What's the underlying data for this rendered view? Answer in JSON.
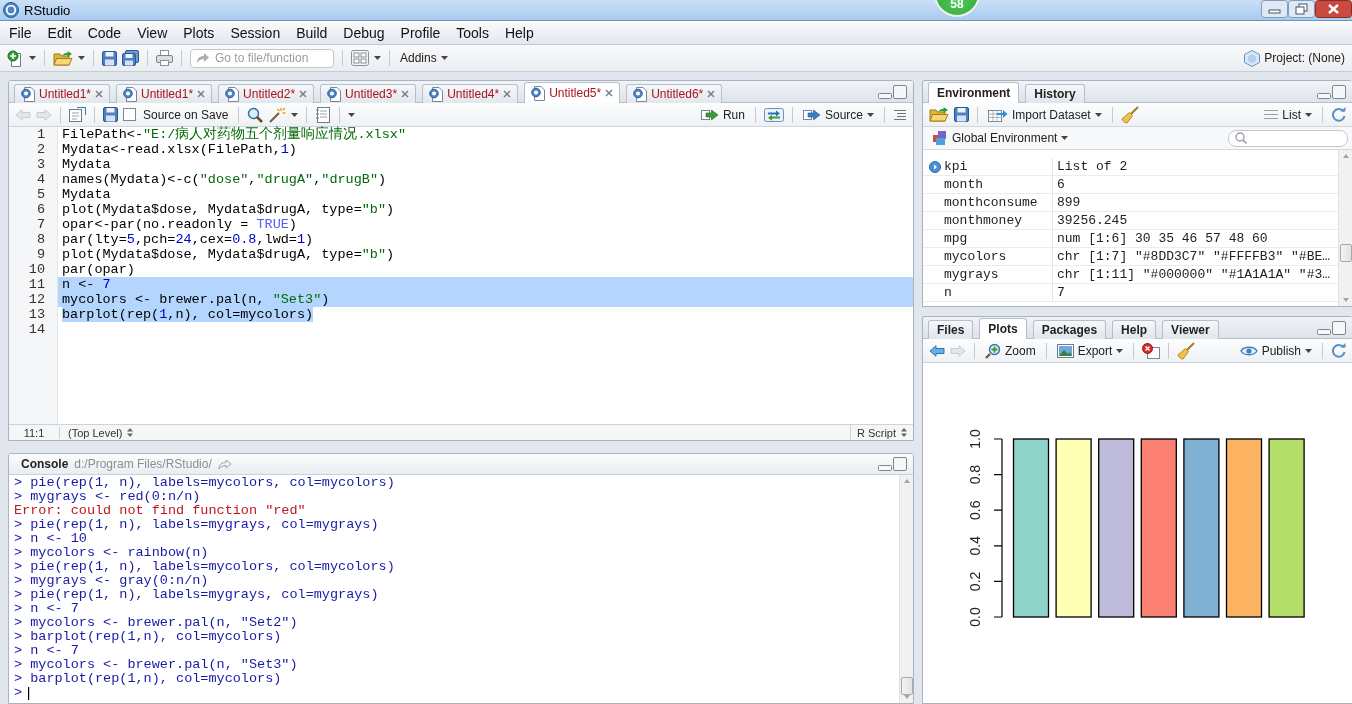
{
  "window": {
    "title": "RStudio",
    "badge": "58"
  },
  "menu": [
    "File",
    "Edit",
    "Code",
    "View",
    "Plots",
    "Session",
    "Build",
    "Debug",
    "Profile",
    "Tools",
    "Help"
  ],
  "toolbar": {
    "goto_placeholder": "Go to file/function",
    "addins": "Addins",
    "project": "Project: (None)"
  },
  "source": {
    "tabs": [
      {
        "label": "Untitled1*",
        "selected": false,
        "modified": true
      },
      {
        "label": "Untitled1*",
        "selected": false,
        "modified": true
      },
      {
        "label": "Untitled2*",
        "selected": false,
        "modified": true
      },
      {
        "label": "Untitled3*",
        "selected": false,
        "modified": true
      },
      {
        "label": "Untitled4*",
        "selected": false,
        "modified": true
      },
      {
        "label": "Untitled5*",
        "selected": true,
        "modified": true
      },
      {
        "label": "Untitled6*",
        "selected": false,
        "modified": true
      }
    ],
    "nav": [
      {
        "kind": "back",
        "disabled": true
      },
      {
        "kind": "forward",
        "disabled": true
      }
    ],
    "source_on_save": {
      "label": "Source on Save",
      "checked": false
    },
    "run": "Run",
    "source": "Source",
    "lines": [
      {
        "number": "1",
        "selected": false,
        "tokens": [
          {
            "kind": "text",
            "text": "FilePath<-"
          },
          {
            "kind": "string",
            "text": "\"E:/病人对药物五个剂量响应情况.xlsx\""
          }
        ]
      },
      {
        "number": "2",
        "selected": false,
        "tokens": [
          {
            "kind": "text",
            "text": "Mydata<-read.xlsx(FilePath,"
          },
          {
            "kind": "number",
            "text": "1"
          },
          {
            "kind": "text",
            "text": ")"
          }
        ]
      },
      {
        "number": "3",
        "selected": false,
        "tokens": [
          {
            "kind": "text",
            "text": "Mydata"
          }
        ]
      },
      {
        "number": "4",
        "selected": false,
        "tokens": [
          {
            "kind": "text",
            "text": "names(Mydata)<-c("
          },
          {
            "kind": "string",
            "text": "\"dose\""
          },
          {
            "kind": "text",
            "text": ","
          },
          {
            "kind": "string",
            "text": "\"drugA\""
          },
          {
            "kind": "text",
            "text": ","
          },
          {
            "kind": "string",
            "text": "\"drugB\""
          },
          {
            "kind": "text",
            "text": ")"
          }
        ]
      },
      {
        "number": "5",
        "selected": false,
        "tokens": [
          {
            "kind": "text",
            "text": "Mydata"
          }
        ]
      },
      {
        "number": "6",
        "selected": false,
        "tokens": [
          {
            "kind": "text",
            "text": "plot(Mydata$dose, Mydata$drugA, type="
          },
          {
            "kind": "string",
            "text": "\"b\""
          },
          {
            "kind": "text",
            "text": ")"
          }
        ]
      },
      {
        "number": "7",
        "selected": false,
        "tokens": [
          {
            "kind": "text",
            "text": "opar<-par(no.readonly = "
          },
          {
            "kind": "keyword",
            "text": "TRUE"
          },
          {
            "kind": "text",
            "text": ")"
          }
        ]
      },
      {
        "number": "8",
        "selected": false,
        "tokens": [
          {
            "kind": "text",
            "text": "par(lty="
          },
          {
            "kind": "number",
            "text": "5"
          },
          {
            "kind": "text",
            "text": ",pch="
          },
          {
            "kind": "number",
            "text": "24"
          },
          {
            "kind": "text",
            "text": ",cex="
          },
          {
            "kind": "number",
            "text": "0.8"
          },
          {
            "kind": "text",
            "text": ",lwd="
          },
          {
            "kind": "number",
            "text": "1"
          },
          {
            "kind": "text",
            "text": ")"
          }
        ]
      },
      {
        "number": "9",
        "selected": false,
        "tokens": [
          {
            "kind": "text",
            "text": "plot(Mydata$dose, Mydata$drugA, type="
          },
          {
            "kind": "string",
            "text": "\"b\""
          },
          {
            "kind": "text",
            "text": ")"
          }
        ]
      },
      {
        "number": "10",
        "selected": false,
        "tokens": [
          {
            "kind": "text",
            "text": "par(opar)"
          }
        ]
      },
      {
        "number": "11",
        "selected": true,
        "tokens": [
          {
            "kind": "text",
            "text": "n <- "
          },
          {
            "kind": "number",
            "text": "7"
          }
        ]
      },
      {
        "number": "12",
        "selected": true,
        "tokens": [
          {
            "kind": "text",
            "text": "mycolors <- brewer.pal(n, "
          },
          {
            "kind": "string",
            "text": "\"Set3\""
          },
          {
            "kind": "text",
            "text": ")"
          }
        ]
      },
      {
        "number": "13",
        "selected": true,
        "tokens": [
          {
            "kind": "text",
            "text": "barplot(rep("
          },
          {
            "kind": "number",
            "text": "1"
          },
          {
            "kind": "text",
            "text": ",n), col=mycolors)"
          }
        ]
      },
      {
        "number": "14",
        "selected": false
      }
    ],
    "status": {
      "position": "11:1",
      "scope": "(Top Level)",
      "file_type": "R Script"
    }
  },
  "console": {
    "title": "Console",
    "path": "d:/Program Files/RStudio/",
    "lines": [
      {
        "kind": "input",
        "text": "> pie(rep(1, n), labels=mycolors, col=mycolors)"
      },
      {
        "kind": "input",
        "text": "> mygrays <- red(0:n/n)"
      },
      {
        "kind": "error",
        "text": "Error: could not find function \"red\""
      },
      {
        "kind": "input",
        "text": "> pie(rep(1, n), labels=mygrays, col=mygrays)"
      },
      {
        "kind": "input",
        "text": "> n <- 10"
      },
      {
        "kind": "input",
        "text": "> mycolors <- rainbow(n)"
      },
      {
        "kind": "input",
        "text": "> pie(rep(1, n), labels=mycolors, col=mycolors)"
      },
      {
        "kind": "input",
        "text": "> mygrays <- gray(0:n/n)"
      },
      {
        "kind": "input",
        "text": "> pie(rep(1, n), labels=mygrays, col=mygrays)"
      },
      {
        "kind": "input",
        "text": "> n <- 7"
      },
      {
        "kind": "input",
        "text": "> mycolors <- brewer.pal(n, \"Set2\")"
      },
      {
        "kind": "input",
        "text": "> barplot(rep(1,n), col=mycolors)"
      },
      {
        "kind": "input",
        "text": "> n <- 7"
      },
      {
        "kind": "input",
        "text": "> mycolors <- brewer.pal(n, \"Set3\")"
      },
      {
        "kind": "input",
        "text": "> barplot(rep(1,n), col=mycolors)"
      }
    ],
    "prompt": ">"
  },
  "environment": {
    "tabs": [
      {
        "label": "Environment",
        "selected": true
      },
      {
        "label": "History",
        "selected": false
      }
    ],
    "import": "Import Dataset",
    "view": "List",
    "scope": "Global Environment",
    "rows": [
      {
        "name": "kpi",
        "value": "List of 2",
        "expandable": true
      },
      {
        "name": "month",
        "value": "6",
        "expandable": false
      },
      {
        "name": "monthconsume",
        "value": "899",
        "expandable": false
      },
      {
        "name": "monthmoney",
        "value": "39256.245",
        "expandable": false
      },
      {
        "name": "mpg",
        "value": "num [1:6] 30 35 46 57 48 60",
        "expandable": false
      },
      {
        "name": "mycolors",
        "value": "chr [1:7] \"#8DD3C7\" \"#FFFFB3\" \"#BE…",
        "expandable": false
      },
      {
        "name": "mygrays",
        "value": "chr [1:11] \"#000000\" \"#1A1A1A\" \"#3…",
        "expandable": false
      },
      {
        "name": "n",
        "value": "7",
        "expandable": false
      }
    ]
  },
  "plots_pane": {
    "tabs": [
      {
        "label": "Files",
        "selected": false
      },
      {
        "label": "Plots",
        "selected": true
      },
      {
        "label": "Packages",
        "selected": false
      },
      {
        "label": "Help",
        "selected": false
      },
      {
        "label": "Viewer",
        "selected": false
      }
    ],
    "nav": [
      {
        "kind": "back",
        "disabled": false
      },
      {
        "kind": "forward",
        "disabled": true
      }
    ],
    "zoom": "Zoom",
    "export": "Export",
    "publish": "Publish",
    "chart_data": {
      "type": "bar",
      "values": [
        1,
        1,
        1,
        1,
        1,
        1,
        1
      ],
      "colors": [
        "#8DD3C7",
        "#FFFFB3",
        "#BEBADA",
        "#FB8072",
        "#80B1D3",
        "#FDB462",
        "#B3DE69"
      ],
      "ylim": [
        0,
        1
      ],
      "yticks": [
        {
          "value": 0,
          "label": "0.0"
        },
        {
          "value": 0.2,
          "label": "0.2"
        },
        {
          "value": 0.4,
          "label": "0.4"
        },
        {
          "value": 0.6,
          "label": "0.6"
        },
        {
          "value": 0.8,
          "label": "0.8"
        },
        {
          "value": 1,
          "label": "1.0"
        }
      ]
    }
  }
}
